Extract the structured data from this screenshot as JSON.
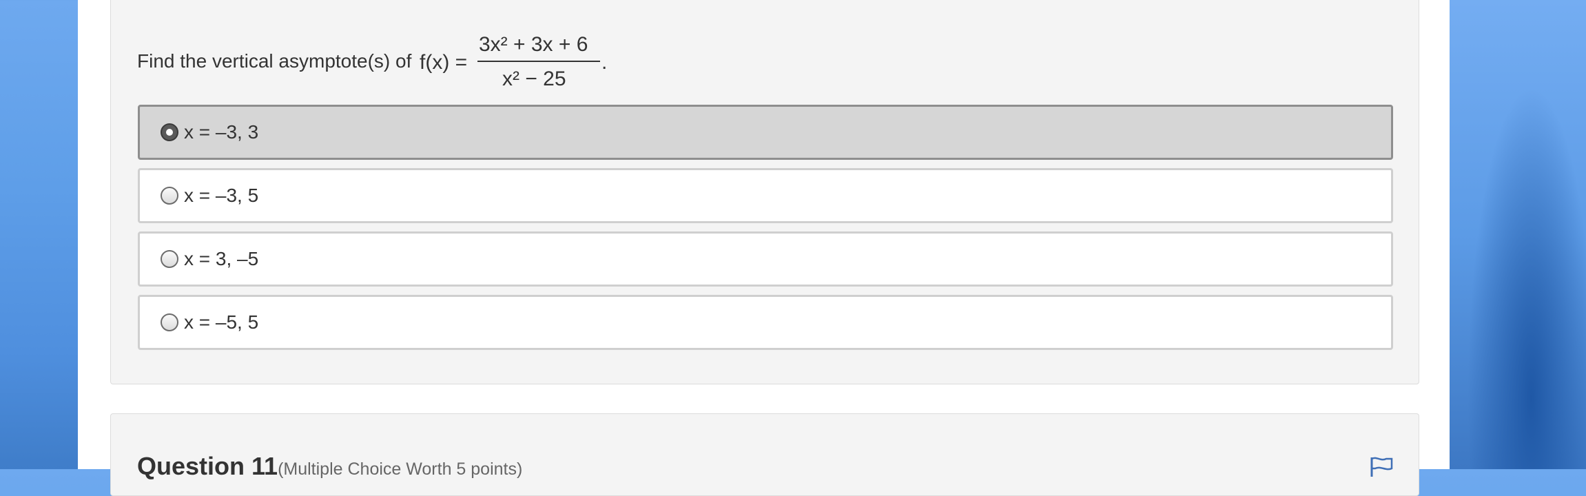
{
  "question": {
    "prompt": "Find the vertical asymptote(s) of",
    "formula": {
      "lhs": "f(x) =",
      "numerator": "3x² + 3x + 6",
      "denominator": "x² − 25",
      "trailing": "."
    },
    "options": [
      {
        "label": "x = –3, 3",
        "selected": true
      },
      {
        "label": "x = –3, 5",
        "selected": false
      },
      {
        "label": "x = 3, –5",
        "selected": false
      },
      {
        "label": "x = –5, 5",
        "selected": false
      }
    ]
  },
  "next_question": {
    "title": "Question 11",
    "meta": "(Multiple Choice Worth 5 points)",
    "flag_icon": "flag-icon"
  }
}
